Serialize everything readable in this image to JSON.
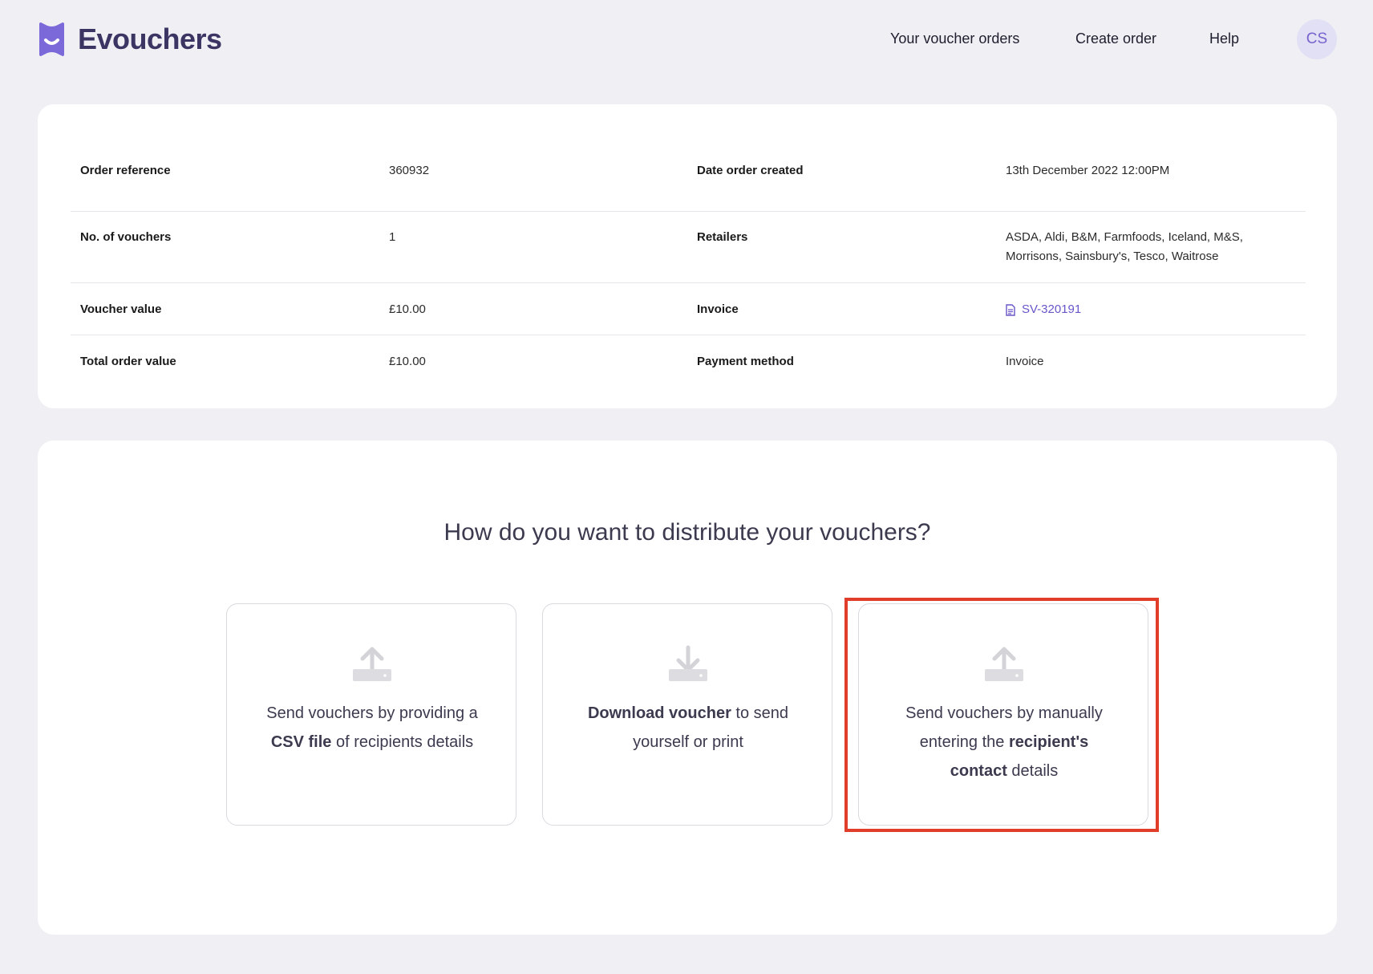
{
  "brand": {
    "name": "Evouchers",
    "accent": "#7b68d9"
  },
  "nav": {
    "orders": "Your voucher orders",
    "create": "Create order",
    "help": "Help",
    "avatar_initials": "CS"
  },
  "order": {
    "rows": [
      {
        "label1": "Order reference",
        "value1": "360932",
        "label2": "Date order created",
        "value2": "13th December 2022 12:00PM"
      },
      {
        "label1": "No. of vouchers",
        "value1": "1",
        "label2": "Retailers",
        "value2": "ASDA, Aldi, B&M, Farmfoods, Iceland, M&S, Morrisons, Sainsbury's, Tesco, Waitrose"
      },
      {
        "label1": "Voucher value",
        "value1": "£10.00",
        "label2": "Invoice",
        "value2": "SV-320191"
      },
      {
        "label1": "Total order value",
        "value1": "£10.00",
        "label2": "Payment method",
        "value2": "Invoice"
      }
    ]
  },
  "distribution": {
    "title": "How do you want to distribute your vouchers?",
    "options": [
      {
        "icon": "upload-icon",
        "pre": "Send vouchers by providing a ",
        "bold": "CSV file",
        "post": " of recipients details"
      },
      {
        "icon": "download-icon",
        "pre": "",
        "bold": "Download voucher",
        "post": " to send yourself or print"
      },
      {
        "icon": "upload-icon",
        "pre": "Send vouchers by manually entering the ",
        "bold": "recipient's contact",
        "post": " details"
      }
    ]
  }
}
